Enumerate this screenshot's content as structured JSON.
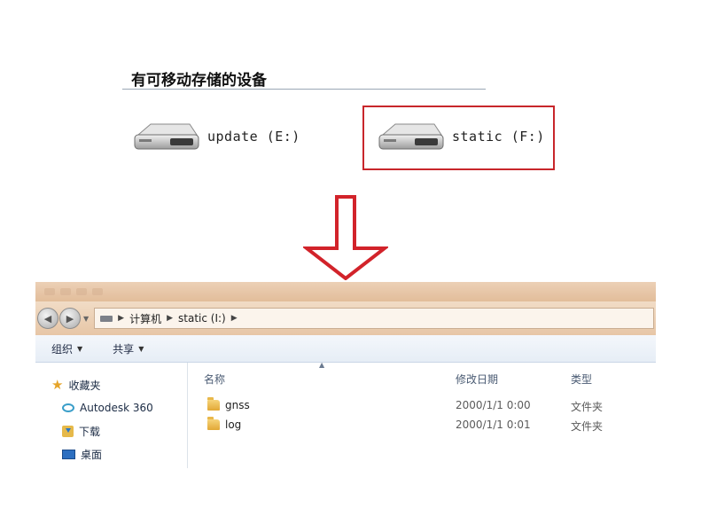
{
  "top_panel": {
    "heading": "有可移动存储的设备",
    "drives": [
      {
        "label": "update (E:)",
        "icon": "removable-drive-icon"
      },
      {
        "label": "static (F:)",
        "icon": "removable-drive-icon",
        "highlighted": true
      }
    ],
    "highlight_color": "#c8262b"
  },
  "explorer": {
    "breadcrumb": [
      "计算机",
      "static (I:)"
    ],
    "toolbar": {
      "organize": "组织",
      "share": "共享"
    },
    "nav_pane": {
      "favorites": "收藏夹",
      "items": [
        "Autodesk 360",
        "下载",
        "桌面"
      ]
    },
    "columns": {
      "name": "名称",
      "date_modified": "修改日期",
      "type": "类型"
    },
    "files": [
      {
        "name": "gnss",
        "date_modified": "2000/1/1 0:00",
        "type": "文件夹"
      },
      {
        "name": "log",
        "date_modified": "2000/1/1 0:01",
        "type": "文件夹"
      }
    ]
  },
  "colors": {
    "titlebar": "#e8c5a5",
    "arrow": "#d2232a"
  }
}
